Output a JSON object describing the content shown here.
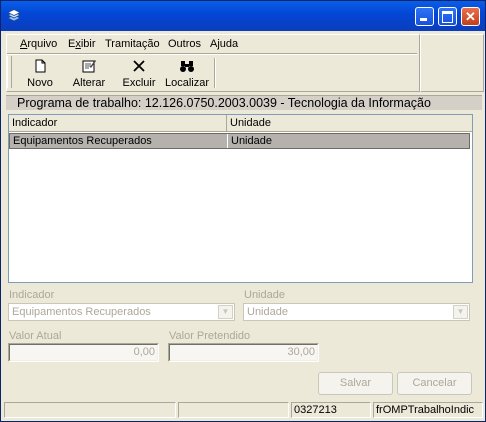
{
  "window": {
    "title": "",
    "icon": "app-layers-icon",
    "controls": [
      "minimize",
      "maximize",
      "close"
    ]
  },
  "menubar": {
    "items": [
      {
        "label": "Arquivo",
        "accel": "A"
      },
      {
        "label": "Exibir",
        "accel": "x"
      },
      {
        "label": "Tramitação",
        "accel": ""
      },
      {
        "label": "Outros",
        "accel": ""
      },
      {
        "label": "Ajuda",
        "accel": "j"
      }
    ]
  },
  "toolbar": {
    "novo": "Novo",
    "alterar": "Alterar",
    "excluir": "Excluir",
    "localizar": "Localizar"
  },
  "program_line": "Programa de trabalho: 12.126.0750.2003.0039 - Tecnologia da Informação",
  "grid": {
    "columns": [
      "Indicador",
      "Unidade"
    ],
    "rows": [
      {
        "indicador": "Equipamentos Recuperados",
        "unidade": "Unidade",
        "selected": true
      }
    ]
  },
  "form": {
    "indicador_label": "Indicador",
    "indicador_value": "Equipamentos Recuperados",
    "unidade_label": "Unidade",
    "unidade_value": "Unidade",
    "valor_atual_label": "Valor Atual",
    "valor_atual": "0,00",
    "valor_pretendido_label": "Valor Pretendido",
    "valor_pretendido": "30,00",
    "enabled": false
  },
  "buttons": {
    "salvar": "Salvar",
    "cancelar": "Cancelar"
  },
  "statusbar": {
    "panels": [
      "",
      "",
      "",
      "0327213",
      "frOMPTrabalhoIndic"
    ]
  },
  "colors": {
    "titlebar": "#0347d6",
    "selected_row": "#b5b2ad",
    "disabled_text": "#aca899",
    "window_bg": "#ece9d8"
  }
}
